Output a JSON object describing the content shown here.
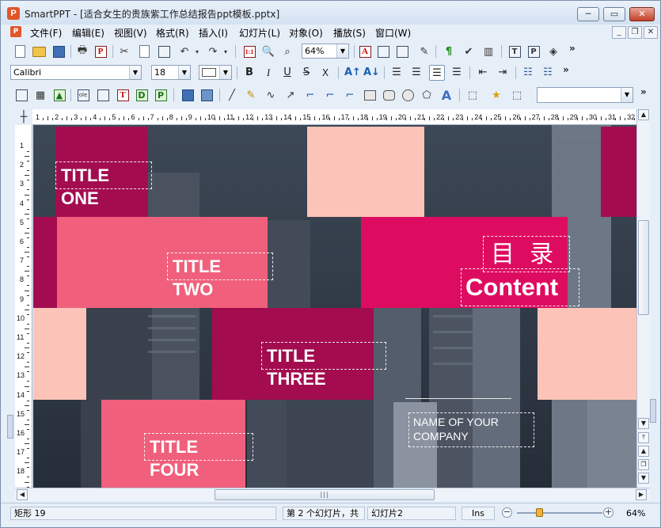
{
  "window": {
    "app_name": "SmartPPT",
    "title": "SmartPPT - [适合女生的贵族紫工作总结报告ppt模板.pptx]",
    "app_icon_letter": "P"
  },
  "menu": {
    "items": [
      {
        "label": "文件(F)"
      },
      {
        "label": "编辑(E)"
      },
      {
        "label": "视图(V)"
      },
      {
        "label": "格式(R)"
      },
      {
        "label": "插入(I)"
      },
      {
        "label": "幻灯片(L)"
      },
      {
        "label": "对象(O)"
      },
      {
        "label": "播放(S)"
      },
      {
        "label": "窗口(W)"
      }
    ]
  },
  "toolbar1": {
    "zoom_value": "64%",
    "more": "»"
  },
  "toolbar2": {
    "font_name": "Calibri",
    "font_size": "18",
    "more": "»",
    "format_buttons": [
      "B",
      "I",
      "U",
      "S",
      "X"
    ]
  },
  "toolbar3": {
    "more": "»",
    "shape_select_value": ""
  },
  "ruler": {
    "h_numbers": [
      "1",
      "2",
      "3",
      "4",
      "5",
      "6",
      "7",
      "8",
      "9",
      "10",
      "11",
      "12",
      "13",
      "14",
      "15",
      "16",
      "17",
      "18",
      "19",
      "20",
      "21",
      "22",
      "23",
      "24",
      "25",
      "26",
      "27",
      "28",
      "29",
      "30",
      "31",
      "32"
    ],
    "v_numbers": [
      "1",
      "2",
      "3",
      "4",
      "5",
      "6",
      "7",
      "8",
      "9",
      "10",
      "11",
      "12",
      "13",
      "14",
      "15",
      "16",
      "17",
      "18"
    ]
  },
  "slide": {
    "title_one": "TITLE\nONE",
    "title_two": "TITLE\nTWO",
    "title_three": "TITLE\nTHREE",
    "title_four": "TITLE\nFOUR",
    "heading_cn": "目  录",
    "heading_en": "Content",
    "company": "NAME OF YOUR\nCOMPANY",
    "colors": {
      "crimson": "#a30d4f",
      "pink": "#f0607c",
      "hot_pink": "#de0c60",
      "peach": "#fcc4b8",
      "photo_dark": "#2f3a48"
    }
  },
  "status": {
    "shape": "矩形 19",
    "slide_pos": "第 2 个幻灯片，共",
    "slide_name": "幻灯片2",
    "mode": "Ins",
    "zoom": "64%"
  }
}
